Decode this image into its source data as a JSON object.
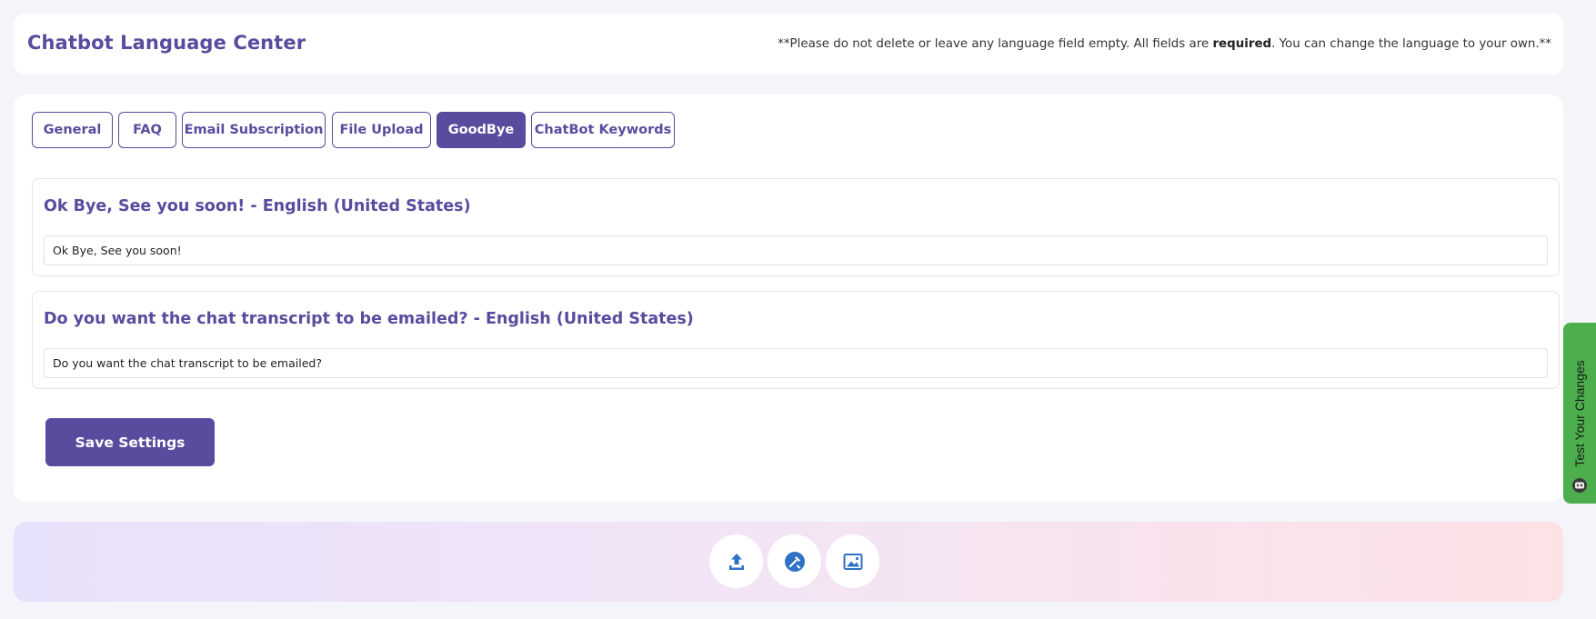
{
  "header": {
    "title": "Chatbot Language Center",
    "note_prefix": "**Please do not delete or leave any language field empty. All fields are ",
    "note_bold": "required",
    "note_suffix": ". You can change the language to your own.**"
  },
  "tabs": [
    {
      "label": "General",
      "active": false
    },
    {
      "label": "FAQ",
      "active": false
    },
    {
      "label": "Email Subscription",
      "active": false
    },
    {
      "label": "File Upload",
      "active": false
    },
    {
      "label": "GoodBye",
      "active": true
    },
    {
      "label": "ChatBot Keywords",
      "active": false
    }
  ],
  "fields": [
    {
      "label": "Ok Bye, See you soon! - English (United States)",
      "value": "Ok Bye, See you soon!"
    },
    {
      "label": "Do you want the chat transcript to be emailed? - English (United States)",
      "value": "Do you want the chat transcript to be emailed?"
    }
  ],
  "save_button": "Save Settings",
  "side_tab": {
    "label": "Test Your Changes",
    "icon": "bot-icon"
  },
  "footer": {
    "icons": [
      "upload-icon",
      "tools-icon",
      "image-icon"
    ]
  },
  "colors": {
    "accent": "#5a4b9e",
    "side_tab": "#4cae4c",
    "icon_blue": "#2f72c4"
  }
}
